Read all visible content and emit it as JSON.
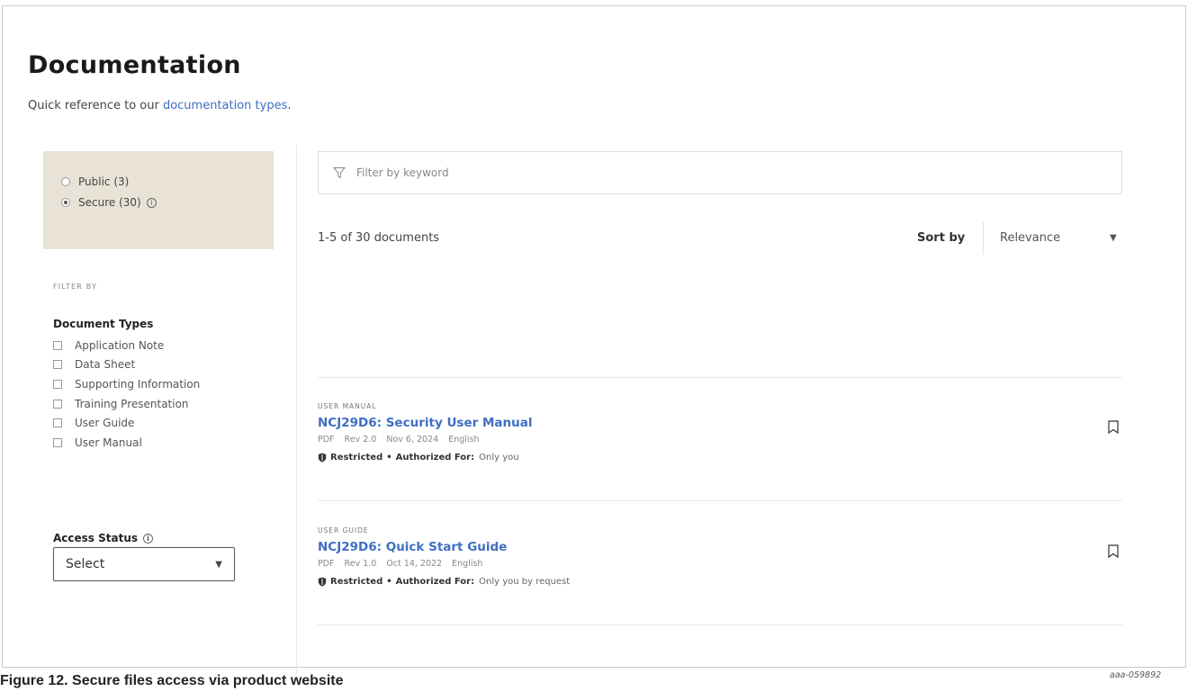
{
  "header": {
    "title": "Documentation",
    "subtitle_prefix": "Quick reference to our ",
    "subtitle_link": "documentation types",
    "subtitle_suffix": "."
  },
  "access_filter": {
    "options": [
      {
        "label": "Public (3)",
        "checked": false
      },
      {
        "label": "Secure (30)",
        "checked": true,
        "info_icon": "info-icon"
      }
    ]
  },
  "sidebar": {
    "filter_by_label": "FILTER BY",
    "doc_types_title": "Document Types",
    "doc_types": [
      "Application Note",
      "Data Sheet",
      "Supporting Information",
      "Training Presentation",
      "User Guide",
      "User Manual"
    ],
    "access_status_title": "Access Status",
    "access_status_select": "Select"
  },
  "search": {
    "placeholder": "Filter by keyword",
    "icon": "filter-icon"
  },
  "results": {
    "count_text": "1-5 of 30 documents",
    "sort_label": "Sort by",
    "sort_value": "Relevance"
  },
  "documents": [
    {
      "type": "USER MANUAL",
      "title": "NCJ29D6: Security User Manual",
      "format": "PDF",
      "rev": "Rev 2.0",
      "date": "Nov 6, 2024",
      "language": "English",
      "restricted": "Restricted",
      "authorized_label": "Authorized For:",
      "authorized_value": "Only you"
    },
    {
      "type": "USER GUIDE",
      "title": "NCJ29D6: Quick Start Guide",
      "format": "PDF",
      "rev": "Rev 1.0",
      "date": "Oct 14, 2022",
      "language": "English",
      "restricted": "Restricted",
      "authorized_label": "Authorized For:",
      "authorized_value": "Only you by request"
    }
  ],
  "figure": {
    "id": "aaa-059892",
    "caption": "Figure 12.  Secure files access via product website"
  }
}
